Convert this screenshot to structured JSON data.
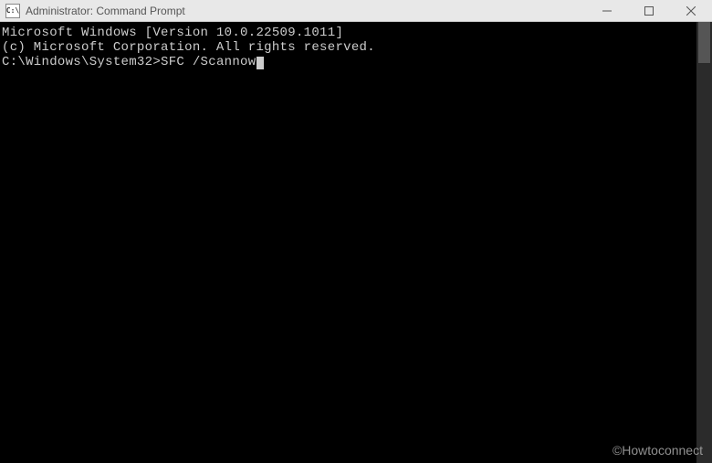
{
  "titlebar": {
    "icon_text": "C:\\",
    "title": "Administrator: Command Prompt"
  },
  "terminal": {
    "line1": "Microsoft Windows [Version 10.0.22509.1011]",
    "line2": "(c) Microsoft Corporation. All rights reserved.",
    "blank": "",
    "prompt": "C:\\Windows\\System32>",
    "command": "SFC /Scannow"
  },
  "watermark": "©Howtoconnect"
}
